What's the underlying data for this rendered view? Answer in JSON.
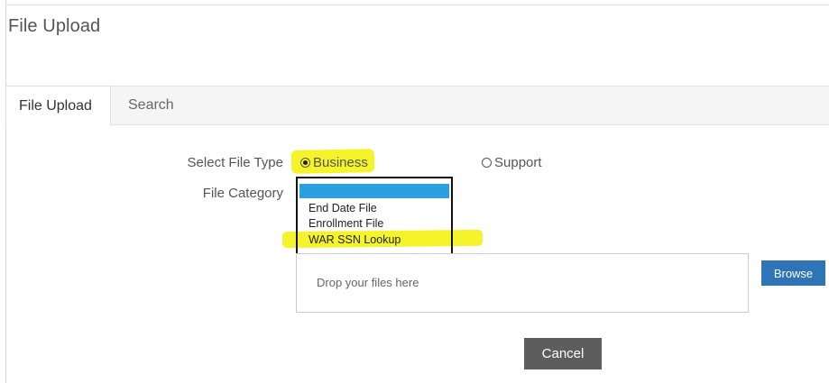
{
  "page": {
    "title": "File Upload"
  },
  "tabs": [
    {
      "label": "File Upload",
      "active": true
    },
    {
      "label": "Search",
      "active": false
    }
  ],
  "form": {
    "file_type": {
      "label": "Select File Type",
      "options": [
        {
          "label": "Business",
          "checked": true
        },
        {
          "label": "Support",
          "checked": false
        }
      ]
    },
    "file_category": {
      "label": "File Category",
      "selected_value": "",
      "options": [
        "End Date File",
        "Enrollment File",
        "WAR SSN Lookup"
      ],
      "selected_color": "#2aa0e0"
    }
  },
  "dropzone": {
    "placeholder": "Drop your files here"
  },
  "buttons": {
    "browse": "Browse",
    "cancel": "Cancel"
  },
  "colors": {
    "highlight": "#f5f42b",
    "browse_bg": "#2d75b6",
    "cancel_bg": "#5d5d5d"
  }
}
